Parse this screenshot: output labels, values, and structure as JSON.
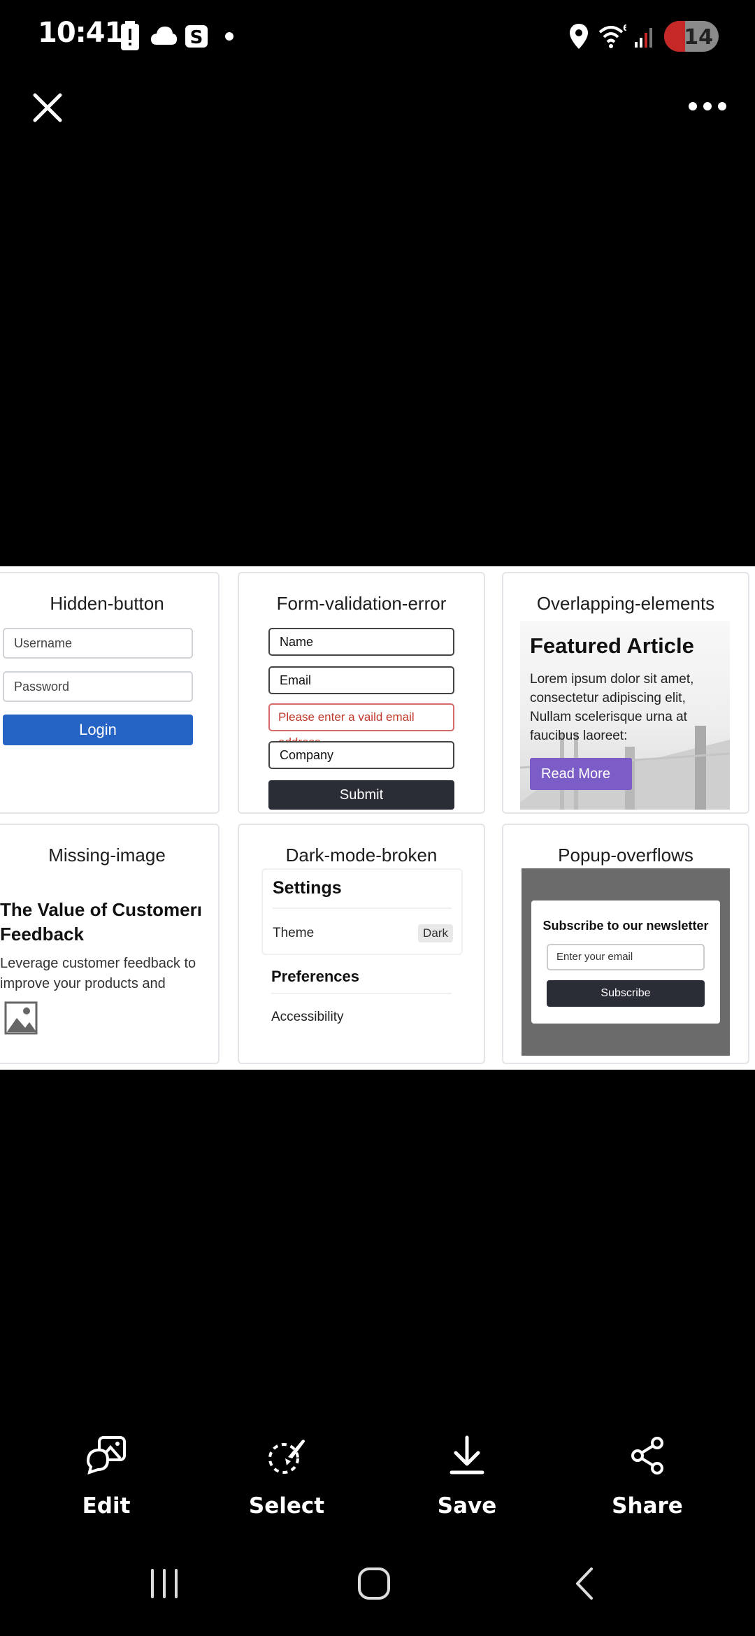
{
  "status_bar": {
    "time": "10:41",
    "battery_level": "14",
    "icons": [
      "battery-alert-icon",
      "cloud-icon",
      "s-app-icon",
      "dot-icon",
      "location-icon",
      "wifi-6-icon",
      "signal-icon"
    ]
  },
  "viewer": {
    "close_icon": "close-icon",
    "more_icon": "more-options-icon"
  },
  "screenshot": {
    "cards": {
      "hidden_button": {
        "title": "Hidden-button",
        "username_placeholder": "Username",
        "password_placeholder": "Password",
        "login_label": "Login"
      },
      "form_validation": {
        "title": "Form-validation-error",
        "name_value": "Name",
        "email_value": "Email",
        "error_message": "Please enter a vaild email address",
        "company_value": "Company",
        "submit_label": "Submit"
      },
      "overlapping": {
        "title": "Overlapping-elements",
        "article_title": "Featured Article",
        "article_body": "Lorem ipsum dolor sit amet, consectetur adipiscing elit, Nullam scelerisque urna at faucibus laoreet:",
        "read_more_label": "Read More"
      },
      "missing_image": {
        "title": "Missing-image",
        "heading": "The Value of Customerı Feedback",
        "body": "Leverage customer feedback to improve your products and"
      },
      "dark_mode": {
        "title": "Dark-mode-broken",
        "settings_heading": "Settings",
        "theme_label": "Theme",
        "theme_value": "Dark",
        "preferences_heading": "Preferences",
        "accessibility_label": "Accessibility"
      },
      "popup": {
        "title": "Popup-overflows",
        "popup_heading": "Subscribe to our newsletter",
        "email_placeholder": "Enter your email",
        "subscribe_label": "Subscribe"
      }
    }
  },
  "toolbar": {
    "items": [
      {
        "label": "Edit",
        "icon": "edit-icon"
      },
      {
        "label": "Select",
        "icon": "select-icon"
      },
      {
        "label": "Save",
        "icon": "save-icon"
      },
      {
        "label": "Share",
        "icon": "share-icon"
      }
    ]
  },
  "nav_bar": {
    "icons": [
      "recents-icon",
      "home-icon",
      "back-icon"
    ]
  },
  "colors": {
    "background": "#000000",
    "login_blue": "#2563c4",
    "read_more_purple": "#7c5cc6",
    "error_red": "#c0392b",
    "battery_red": "#c62828"
  }
}
